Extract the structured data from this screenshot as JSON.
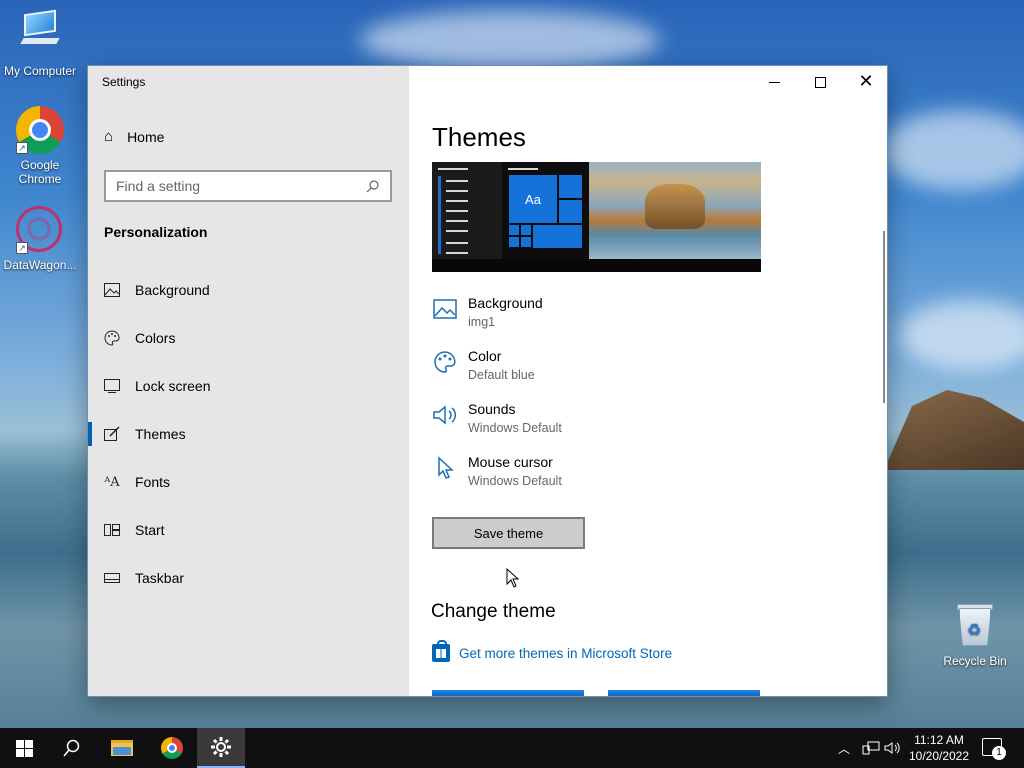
{
  "desktop": {
    "icons": [
      {
        "label": "My Computer",
        "icon": "computer-icon"
      },
      {
        "label": "Google Chrome",
        "icon": "chrome-icon"
      },
      {
        "label": "DataWagon...",
        "icon": "datawagon-icon"
      },
      {
        "label": "Recycle Bin",
        "icon": "recycle-bin-icon"
      }
    ]
  },
  "window": {
    "title": "Settings",
    "controls": {
      "minimize": "minimize-icon",
      "maximize": "maximize-icon",
      "close": "close-icon"
    }
  },
  "sidebar": {
    "home_label": "Home",
    "search_placeholder": "Find a setting",
    "section_title": "Personalization",
    "items": [
      {
        "label": "Background",
        "icon": "picture-icon",
        "glyph": "🖼"
      },
      {
        "label": "Colors",
        "icon": "palette-icon",
        "glyph": "🎨"
      },
      {
        "label": "Lock screen",
        "icon": "lock-screen-icon",
        "glyph": "▭"
      },
      {
        "label": "Themes",
        "icon": "themes-icon",
        "glyph": "✎",
        "active": true
      },
      {
        "label": "Fonts",
        "icon": "fonts-icon",
        "glyph": "A"
      },
      {
        "label": "Start",
        "icon": "start-icon",
        "glyph": "⊞"
      },
      {
        "label": "Taskbar",
        "icon": "taskbar-icon",
        "glyph": "▬"
      }
    ],
    "accent_color": "#0063b1"
  },
  "content": {
    "heading": "Themes",
    "preview_tile_label": "Aa",
    "properties": [
      {
        "title": "Background",
        "value": "img1",
        "icon": "picture-icon"
      },
      {
        "title": "Color",
        "value": "Default blue",
        "icon": "palette-icon"
      },
      {
        "title": "Sounds",
        "value": "Windows Default",
        "icon": "speaker-icon"
      },
      {
        "title": "Mouse cursor",
        "value": "Windows Default",
        "icon": "cursor-icon"
      }
    ],
    "save_button": "Save theme",
    "change_heading": "Change theme",
    "store_link": "Get more themes in Microsoft Store",
    "link_color": "#0067b8"
  },
  "taskbar": {
    "clock_time": "11:12 AM",
    "clock_date": "10/20/2022",
    "notification_count": "1",
    "apps": [
      "start-icon",
      "search-icon",
      "file-explorer-icon",
      "chrome-icon",
      "settings-icon"
    ]
  }
}
